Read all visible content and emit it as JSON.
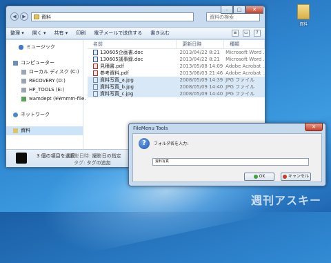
{
  "desktop": {
    "folder_label": "資料",
    "watermark": "週刊アスキー"
  },
  "explorer": {
    "breadcrumb": "資料",
    "search_placeholder": "資料の検索",
    "toolbar": {
      "organize": "整理 ▾",
      "open": "開く ▾",
      "share": "共有 ▾",
      "print": "印刷",
      "email": "電子メールで送信する",
      "burn": "書き込む"
    },
    "nav": {
      "music": "ミュージック",
      "computer": "コンピューター",
      "local_disk": "ローカル ディスク (C:)",
      "recovery": "RECOVERY (D:)",
      "hp_tools": "HP_TOOLS (E:)",
      "wamdept": "wamdept (¥¥mmm-file.",
      "network": "ネットワーク",
      "folder": "資料"
    },
    "columns": {
      "name": "名前",
      "date": "更新日時",
      "type": "種類"
    },
    "files": [
      {
        "name": "130605企画書.doc",
        "date": "2013/04/22 8:21",
        "type": "Microsoft Word ..."
      },
      {
        "name": "130605議事録.doc",
        "date": "2013/04/22 8:21",
        "type": "Microsoft Word ..."
      },
      {
        "name": "見積書.pdf",
        "date": "2013/05/08 14:09",
        "type": "Adobe Acrobat ..."
      },
      {
        "name": "参考資料.pdf",
        "date": "2013/06/03 21:46",
        "type": "Adobe Acrobat ..."
      },
      {
        "name": "資料写真_a.jpg",
        "date": "2008/05/09 14:39",
        "type": "JPG ファイル"
      },
      {
        "name": "資料写真_b.jpg",
        "date": "2008/05/09 14:40",
        "type": "JPG ファイル"
      },
      {
        "name": "資料写真_c.jpg",
        "date": "2008/05/09 14:40",
        "type": "JPG ファイル"
      }
    ],
    "status": {
      "selected": "3 個の項目を選択",
      "shot_label": "撮影日時:",
      "shot_value": "撮影日の指定",
      "tag_label": "タグ:",
      "tag_value": "タグの追加"
    }
  },
  "dialog": {
    "title": "FileMenu Tools",
    "close": "✕",
    "prompt": "フォルダ名を入力:",
    "input_value": "資料写真",
    "ok": "OK",
    "cancel": "キャンセル"
  }
}
